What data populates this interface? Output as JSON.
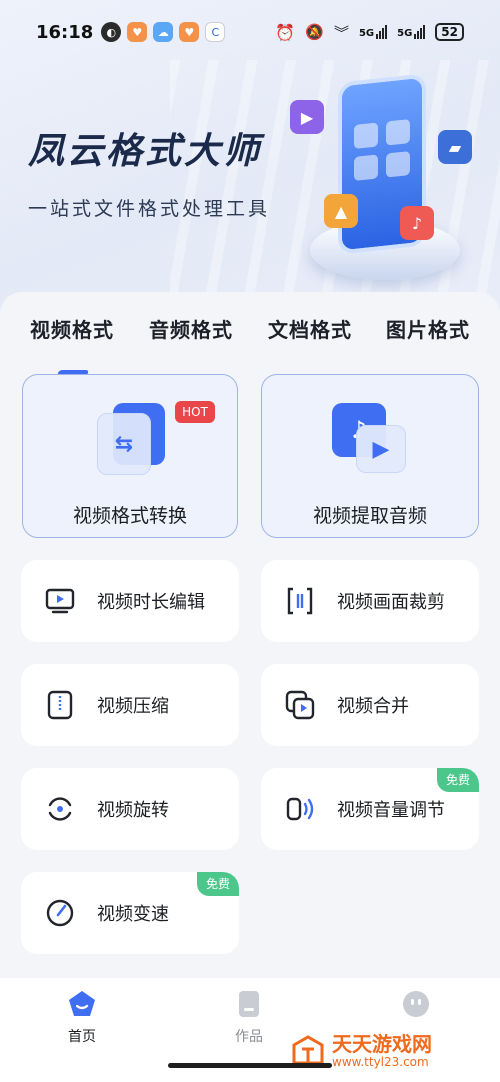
{
  "status_bar": {
    "time": "16:18",
    "battery": "52",
    "network_5g_1": "5G",
    "network_5g_2": "5G"
  },
  "hero": {
    "title": "凤云格式大师",
    "subtitle": "一站式文件格式处理工具"
  },
  "tabs": [
    {
      "label": "视频格式",
      "active": true
    },
    {
      "label": "音频格式",
      "active": false
    },
    {
      "label": "文档格式",
      "active": false
    },
    {
      "label": "图片格式",
      "active": false
    }
  ],
  "features": [
    {
      "label": "视频格式转换",
      "badge": "HOT",
      "icon": "swap-arrows-icon"
    },
    {
      "label": "视频提取音频",
      "icon": "music-play-icon"
    }
  ],
  "tools": [
    {
      "label": "视频时长编辑",
      "icon": "screen-play-icon"
    },
    {
      "label": "视频画面裁剪",
      "icon": "crop-brackets-icon"
    },
    {
      "label": "视频压缩",
      "icon": "zip-file-icon"
    },
    {
      "label": "视频合并",
      "icon": "merge-play-icon"
    },
    {
      "label": "视频旋转",
      "icon": "rotate-icon"
    },
    {
      "label": "视频音量调节",
      "icon": "volume-icon",
      "badge": "免费"
    },
    {
      "label": "视频变速",
      "icon": "speed-gauge-icon",
      "badge": "免费"
    }
  ],
  "bottom_nav": [
    {
      "label": "首页",
      "icon": "home-icon",
      "active": true
    },
    {
      "label": "作品",
      "icon": "works-icon",
      "active": false
    },
    {
      "label": "",
      "icon": "profile-icon",
      "active": false
    }
  ],
  "watermark": {
    "name": "天天游戏网",
    "url": "www.ttyl23.com"
  },
  "colors": {
    "accent": "#3f6ef2",
    "hot_badge": "#e9464a",
    "free_badge": "#4cc78c"
  }
}
